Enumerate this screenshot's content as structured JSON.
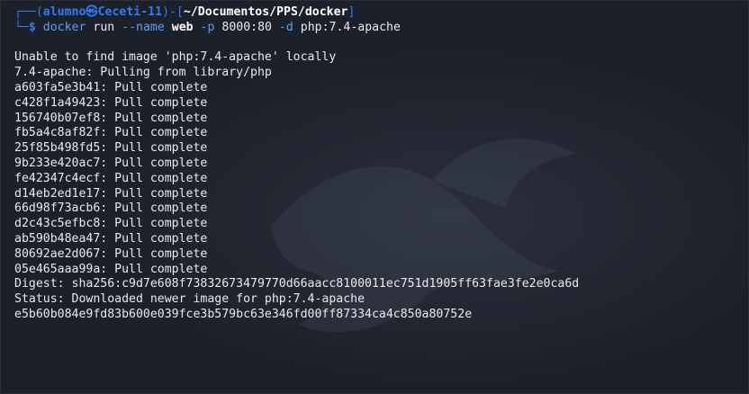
{
  "prompt": {
    "top_left": "┌──(",
    "user": "alumno",
    "at_icon": "㉿",
    "host": "Ceceti-11",
    "mid": ")-[",
    "path": "~/Documentos/PPS/docker",
    "close": "]",
    "bottom_left": "└─",
    "dollar": "$"
  },
  "command": {
    "program": "docker",
    "subcommand": "run",
    "name_flag": "--name",
    "name_value": "web",
    "port_flag": "-p",
    "port_value": "8000:80",
    "detach_flag": "-d",
    "image": "php:7.4-apache"
  },
  "output": [
    "Unable to find image 'php:7.4-apache' locally",
    "7.4-apache: Pulling from library/php",
    "a603fa5e3b41: Pull complete",
    "c428f1a49423: Pull complete",
    "156740b07ef8: Pull complete",
    "fb5a4c8af82f: Pull complete",
    "25f85b498fd5: Pull complete",
    "9b233e420ac7: Pull complete",
    "fe42347c4ecf: Pull complete",
    "d14eb2ed1e17: Pull complete",
    "66d98f73acb6: Pull complete",
    "d2c43c5efbc8: Pull complete",
    "ab590b48ea47: Pull complete",
    "80692ae2d067: Pull complete",
    "05e465aaa99a: Pull complete",
    "Digest: sha256:c9d7e608f73832673479770d66aacc8100011ec751d1905ff63fae3fe2e0ca6d",
    "Status: Downloaded newer image for php:7.4-apache",
    "e5b60b084e9fd83b600e039fce3b579bc63e346fd00ff87334ca4c850a80752e"
  ],
  "colors": {
    "background": "#1c202a",
    "prompt_blue": "#2f7cf6",
    "command_blue": "#5aa0f0",
    "text": "#e8eaee"
  }
}
